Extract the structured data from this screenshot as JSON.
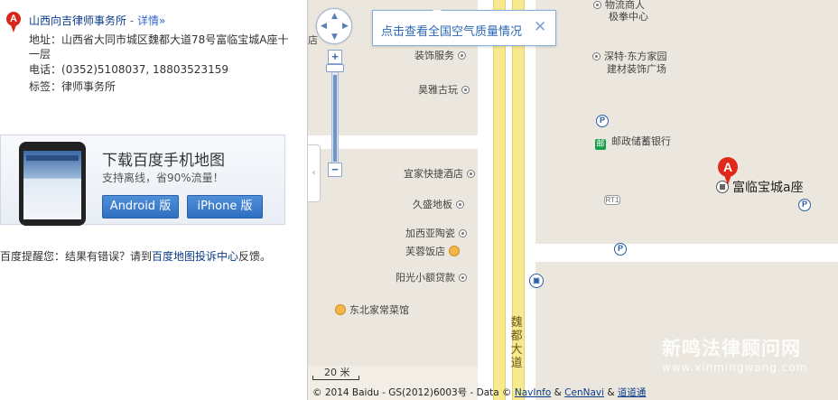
{
  "poi": {
    "marker_letter": "A",
    "name": "山西向吉律师事务所",
    "separator": " - ",
    "detail_link": "详情»",
    "address_label": "地址：",
    "address_value": "山西省大同市城区魏都大道78号富临宝城A座十一层",
    "phone_label": "电话：",
    "phone_value": "(0352)5108037, 18803523159",
    "tags_label": "标签：",
    "tags_value": "律师事务所"
  },
  "banner": {
    "title": "下载百度手机地图",
    "subtitle": "支持离线，省90%流量！",
    "android_button": "Android 版",
    "iphone_button": "iPhone 版"
  },
  "notice": {
    "prefix": "百度提醒您：结果有错误？请到",
    "link": "百度地图投诉中心",
    "suffix": "反馈。"
  },
  "map": {
    "air_quality_text": "点击查看全国空气质量情况",
    "close_glyph": "✕",
    "zoom_in": "+",
    "zoom_out": "−",
    "collapse_glyph": "‹",
    "target_marker_letter": "A",
    "target_label": "富临宝城a座",
    "road_name": "魏都大道",
    "road_tag": "RT1",
    "scale": "20 米",
    "copyright_prefix": "© 2014 Baidu - GS(2012)6003号 - Data ©",
    "copyright_link1": "NavInfo",
    "copyright_amp1": "&",
    "copyright_link2": "CenNavi",
    "copyright_amp2": "&",
    "copyright_link3": "道道通",
    "watermark": "新鸣法律顾问网",
    "watermark_url": "www.xinmingwang.com",
    "poi_labels": {
      "top_partial": "物流商人",
      "gym": "极拳中心",
      "shentesheng": "深特·东方家园",
      "building_materials": "建材装饰广场",
      "decoration": "装饰服务",
      "antiques": "昊雅古玩",
      "postal_bank": "邮政储蓄银行",
      "hotel": "宜家快捷酒店",
      "flooring": "久盛地板",
      "ceramics": "加西亚陶瓷",
      "restaurant": "芙蓉饭店",
      "loan": "阳光小额贷款",
      "northeast_food": "东北家常菜馆",
      "partial_left": "店"
    }
  }
}
